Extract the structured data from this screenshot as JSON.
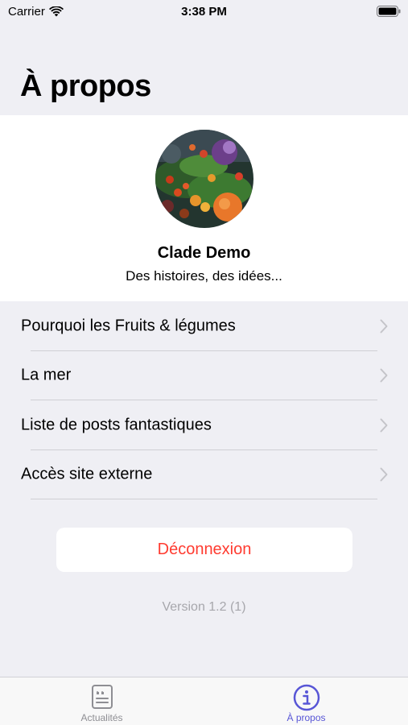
{
  "status_bar": {
    "carrier": "Carrier",
    "time": "3:38 PM",
    "icons": [
      "wifi-icon",
      "battery-icon"
    ]
  },
  "page": {
    "title": "À propos"
  },
  "profile": {
    "name": "Clade Demo",
    "tagline": "Des histoires, des idées...",
    "avatar_icon": "vegetables-photo"
  },
  "menu": {
    "items": [
      {
        "label": "Pourquoi les Fruits & légumes",
        "icon": "chevron-right-icon"
      },
      {
        "label": "La mer",
        "icon": "chevron-right-icon"
      },
      {
        "label": "Liste de posts fantastiques",
        "icon": "chevron-right-icon"
      },
      {
        "label": "Accès site externe",
        "icon": "chevron-right-icon"
      }
    ]
  },
  "logout": {
    "label": "Déconnexion",
    "color": "#ff3b30"
  },
  "version": "Version 1.2 (1)",
  "tab_bar": {
    "tabs": [
      {
        "label": "Actualités",
        "icon": "news-icon",
        "selected": false
      },
      {
        "label": "À propos",
        "icon": "info-icon",
        "selected": true
      }
    ],
    "active_color": "#5856d6",
    "inactive_color": "#8e8e93"
  }
}
